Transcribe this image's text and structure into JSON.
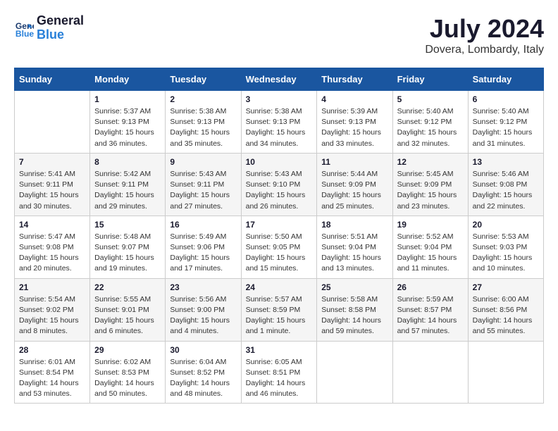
{
  "header": {
    "logo_line1": "General",
    "logo_line2": "Blue",
    "month_year": "July 2024",
    "location": "Dovera, Lombardy, Italy"
  },
  "days_of_week": [
    "Sunday",
    "Monday",
    "Tuesday",
    "Wednesday",
    "Thursday",
    "Friday",
    "Saturday"
  ],
  "weeks": [
    [
      {
        "day": "",
        "sunrise": "",
        "sunset": "",
        "daylight": ""
      },
      {
        "day": "1",
        "sunrise": "Sunrise: 5:37 AM",
        "sunset": "Sunset: 9:13 PM",
        "daylight": "Daylight: 15 hours and 36 minutes."
      },
      {
        "day": "2",
        "sunrise": "Sunrise: 5:38 AM",
        "sunset": "Sunset: 9:13 PM",
        "daylight": "Daylight: 15 hours and 35 minutes."
      },
      {
        "day": "3",
        "sunrise": "Sunrise: 5:38 AM",
        "sunset": "Sunset: 9:13 PM",
        "daylight": "Daylight: 15 hours and 34 minutes."
      },
      {
        "day": "4",
        "sunrise": "Sunrise: 5:39 AM",
        "sunset": "Sunset: 9:13 PM",
        "daylight": "Daylight: 15 hours and 33 minutes."
      },
      {
        "day": "5",
        "sunrise": "Sunrise: 5:40 AM",
        "sunset": "Sunset: 9:12 PM",
        "daylight": "Daylight: 15 hours and 32 minutes."
      },
      {
        "day": "6",
        "sunrise": "Sunrise: 5:40 AM",
        "sunset": "Sunset: 9:12 PM",
        "daylight": "Daylight: 15 hours and 31 minutes."
      }
    ],
    [
      {
        "day": "7",
        "sunrise": "Sunrise: 5:41 AM",
        "sunset": "Sunset: 9:11 PM",
        "daylight": "Daylight: 15 hours and 30 minutes."
      },
      {
        "day": "8",
        "sunrise": "Sunrise: 5:42 AM",
        "sunset": "Sunset: 9:11 PM",
        "daylight": "Daylight: 15 hours and 29 minutes."
      },
      {
        "day": "9",
        "sunrise": "Sunrise: 5:43 AM",
        "sunset": "Sunset: 9:11 PM",
        "daylight": "Daylight: 15 hours and 27 minutes."
      },
      {
        "day": "10",
        "sunrise": "Sunrise: 5:43 AM",
        "sunset": "Sunset: 9:10 PM",
        "daylight": "Daylight: 15 hours and 26 minutes."
      },
      {
        "day": "11",
        "sunrise": "Sunrise: 5:44 AM",
        "sunset": "Sunset: 9:09 PM",
        "daylight": "Daylight: 15 hours and 25 minutes."
      },
      {
        "day": "12",
        "sunrise": "Sunrise: 5:45 AM",
        "sunset": "Sunset: 9:09 PM",
        "daylight": "Daylight: 15 hours and 23 minutes."
      },
      {
        "day": "13",
        "sunrise": "Sunrise: 5:46 AM",
        "sunset": "Sunset: 9:08 PM",
        "daylight": "Daylight: 15 hours and 22 minutes."
      }
    ],
    [
      {
        "day": "14",
        "sunrise": "Sunrise: 5:47 AM",
        "sunset": "Sunset: 9:08 PM",
        "daylight": "Daylight: 15 hours and 20 minutes."
      },
      {
        "day": "15",
        "sunrise": "Sunrise: 5:48 AM",
        "sunset": "Sunset: 9:07 PM",
        "daylight": "Daylight: 15 hours and 19 minutes."
      },
      {
        "day": "16",
        "sunrise": "Sunrise: 5:49 AM",
        "sunset": "Sunset: 9:06 PM",
        "daylight": "Daylight: 15 hours and 17 minutes."
      },
      {
        "day": "17",
        "sunrise": "Sunrise: 5:50 AM",
        "sunset": "Sunset: 9:05 PM",
        "daylight": "Daylight: 15 hours and 15 minutes."
      },
      {
        "day": "18",
        "sunrise": "Sunrise: 5:51 AM",
        "sunset": "Sunset: 9:04 PM",
        "daylight": "Daylight: 15 hours and 13 minutes."
      },
      {
        "day": "19",
        "sunrise": "Sunrise: 5:52 AM",
        "sunset": "Sunset: 9:04 PM",
        "daylight": "Daylight: 15 hours and 11 minutes."
      },
      {
        "day": "20",
        "sunrise": "Sunrise: 5:53 AM",
        "sunset": "Sunset: 9:03 PM",
        "daylight": "Daylight: 15 hours and 10 minutes."
      }
    ],
    [
      {
        "day": "21",
        "sunrise": "Sunrise: 5:54 AM",
        "sunset": "Sunset: 9:02 PM",
        "daylight": "Daylight: 15 hours and 8 minutes."
      },
      {
        "day": "22",
        "sunrise": "Sunrise: 5:55 AM",
        "sunset": "Sunset: 9:01 PM",
        "daylight": "Daylight: 15 hours and 6 minutes."
      },
      {
        "day": "23",
        "sunrise": "Sunrise: 5:56 AM",
        "sunset": "Sunset: 9:00 PM",
        "daylight": "Daylight: 15 hours and 4 minutes."
      },
      {
        "day": "24",
        "sunrise": "Sunrise: 5:57 AM",
        "sunset": "Sunset: 8:59 PM",
        "daylight": "Daylight: 15 hours and 1 minute."
      },
      {
        "day": "25",
        "sunrise": "Sunrise: 5:58 AM",
        "sunset": "Sunset: 8:58 PM",
        "daylight": "Daylight: 14 hours and 59 minutes."
      },
      {
        "day": "26",
        "sunrise": "Sunrise: 5:59 AM",
        "sunset": "Sunset: 8:57 PM",
        "daylight": "Daylight: 14 hours and 57 minutes."
      },
      {
        "day": "27",
        "sunrise": "Sunrise: 6:00 AM",
        "sunset": "Sunset: 8:56 PM",
        "daylight": "Daylight: 14 hours and 55 minutes."
      }
    ],
    [
      {
        "day": "28",
        "sunrise": "Sunrise: 6:01 AM",
        "sunset": "Sunset: 8:54 PM",
        "daylight": "Daylight: 14 hours and 53 minutes."
      },
      {
        "day": "29",
        "sunrise": "Sunrise: 6:02 AM",
        "sunset": "Sunset: 8:53 PM",
        "daylight": "Daylight: 14 hours and 50 minutes."
      },
      {
        "day": "30",
        "sunrise": "Sunrise: 6:04 AM",
        "sunset": "Sunset: 8:52 PM",
        "daylight": "Daylight: 14 hours and 48 minutes."
      },
      {
        "day": "31",
        "sunrise": "Sunrise: 6:05 AM",
        "sunset": "Sunset: 8:51 PM",
        "daylight": "Daylight: 14 hours and 46 minutes."
      },
      {
        "day": "",
        "sunrise": "",
        "sunset": "",
        "daylight": ""
      },
      {
        "day": "",
        "sunrise": "",
        "sunset": "",
        "daylight": ""
      },
      {
        "day": "",
        "sunrise": "",
        "sunset": "",
        "daylight": ""
      }
    ]
  ]
}
